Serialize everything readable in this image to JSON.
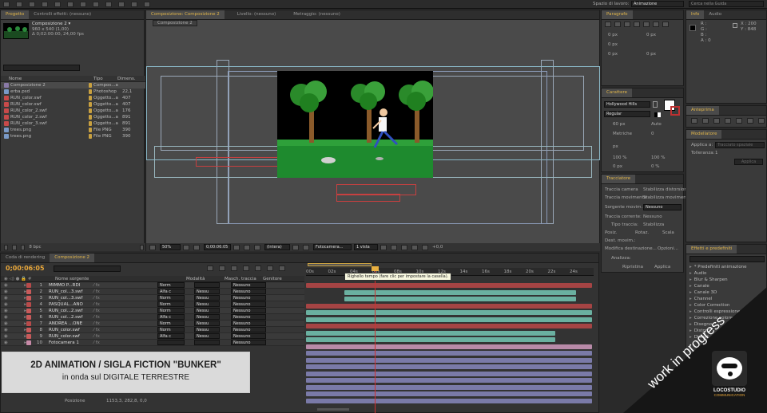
{
  "topbar": {
    "workspace_label": "Spazio di lavoro:",
    "workspace_value": "Animazione",
    "search_placeholder": "Cerca nella Guida"
  },
  "project": {
    "tab": "Progetto",
    "tab2": "Controlli effetti: (nessuno)",
    "selected_name": "Composizione 2 ▾",
    "selected_info1": "960 x 540 (1,00)",
    "selected_info2": "Δ 0;02:00:00, 24,00 fps",
    "headers": [
      "Nome",
      "Tipo",
      "Dimens."
    ],
    "items": [
      {
        "name": "Composizione 2",
        "type": "Compos...a",
        "size": "",
        "color": "#8a7aa8"
      },
      {
        "name": "erba.psd",
        "type": "Photoshop",
        "size": "22,1",
        "color": "#7a9ac8"
      },
      {
        "name": "RUN_color.swf",
        "type": "Oggetto...a",
        "size": "407",
        "color": "#c84a4a"
      },
      {
        "name": "RUN_color.swf",
        "type": "Oggetto...a",
        "size": "407",
        "color": "#c84a4a"
      },
      {
        "name": "RUN_color_2.swf",
        "type": "Oggetto...a",
        "size": "176",
        "color": "#c84a4a"
      },
      {
        "name": "RUN_color_2.swf",
        "type": "Oggetto...a",
        "size": "891",
        "color": "#c84a4a"
      },
      {
        "name": "RUN_color_3.swf",
        "type": "Oggetto...a",
        "size": "891",
        "color": "#c84a4a"
      },
      {
        "name": "trees.png",
        "type": "File PNG",
        "size": "390",
        "color": "#7a9ac8"
      },
      {
        "name": "trees.png",
        "type": "File PNG",
        "size": "390",
        "color": "#7a9ac8"
      }
    ],
    "bpc": "8 bpc"
  },
  "viewer": {
    "tab_comp": "Composizione: Composizione 2",
    "tab_layer": "Livello: (nessuno)",
    "tab_footage": "Metraggio: (nessuno)",
    "subtab": "Composizione 2",
    "zoom": "50%",
    "timecode": "0;00:06:05",
    "resolution": "(Intera)",
    "camera": "Fotocamera...",
    "views": "1 vista",
    "exposure": "+0,0"
  },
  "paragraph": {
    "tab": "Paragrafo",
    "values": [
      "0 px",
      "0 px",
      "0 px",
      "0 px",
      "0 px"
    ]
  },
  "info": {
    "tab": "Info",
    "tab2": "Audio",
    "x": "X : 200",
    "y": "Y : 848",
    "r": "R :",
    "g": "G :",
    "b": "B :",
    "a": "A : 0"
  },
  "preview": {
    "tab": "Anteprima"
  },
  "smoother": {
    "tab": "Modellatore",
    "apply_to_label": "Applica a:",
    "apply_to_value": "Tracciato spaziale",
    "tolerance_label": "Tolleranza:",
    "tolerance_value": "1",
    "apply_button": "Applica"
  },
  "character": {
    "tab": "Carattere",
    "font": "Hollywood Hills",
    "style": "Regular",
    "size": "60 px",
    "leading": "Auto",
    "kerning": "Metriche",
    "tracking": "0",
    "stroke": "px",
    "scale_v": "100 %",
    "scale_h": "100 %",
    "baseline": "0 px",
    "tsume": "0 %"
  },
  "tracker": {
    "tab": "Tracciatore",
    "btn1": "Traccia camera",
    "btn2": "Stabilizza distorsione",
    "btn3": "Traccia movimento",
    "btn4": "Stabilizza movimento",
    "source_label": "Sorgente movim.:",
    "source_value": "Nessuno",
    "current_track_label": "Traccia corrente:",
    "current_track_value": "Nessuno",
    "track_type_label": "Tipo traccia:",
    "track_type_value": "Stabilizza",
    "check1": "Posiz.",
    "check2": "Rotaz.",
    "check3": "Scala",
    "dest_label": "Dest. movim.:",
    "modify_target": "Modifica destinazione...",
    "options": "Opzioni...",
    "analyze_label": "Analizza:",
    "reset": "Ripristina",
    "apply": "Applica"
  },
  "effects": {
    "tab": "Effetti e predefiniti",
    "items": [
      "* Predefiniti animazione",
      "Audio",
      "Blur & Sharpen",
      "Canale",
      "Canale 3D",
      "Channel",
      "Color Correction",
      "Controlli espressione",
      "Correzione colore",
      "Disegno",
      "Distorci",
      "Distort"
    ]
  },
  "timeline": {
    "tab_render": "Coda di rendering",
    "tab_comp": "Composizione 2",
    "timecode": "0;00:06:05",
    "col_source": "Nome sorgente",
    "col_mode": "Modalità",
    "col_trackmatte": "Masch. traccia",
    "col_parent": "Genitore",
    "layers": [
      {
        "num": "1",
        "name": "MIMMO P...RDI",
        "mode": "Norm",
        "matte": "",
        "parent": "Nessuno",
        "color": "#b84a4a"
      },
      {
        "num": "2",
        "name": "RUN_col...3.swf",
        "mode": "Alfa c",
        "matte": "Nessu",
        "parent": "Nessuno",
        "color": "#c85a5a"
      },
      {
        "num": "3",
        "name": "RUN_col...3.swf",
        "mode": "Norm",
        "matte": "Nessu",
        "parent": "Nessuno",
        "color": "#c85a5a"
      },
      {
        "num": "4",
        "name": "PASQUAL...ANO",
        "mode": "Norm",
        "matte": "Nessu",
        "parent": "Nessuno",
        "color": "#b84a4a"
      },
      {
        "num": "5",
        "name": "RUN_col...2.swf",
        "mode": "Norm",
        "matte": "Nessu",
        "parent": "Nessuno",
        "color": "#c85a5a"
      },
      {
        "num": "6",
        "name": "RUN_col...2.swf",
        "mode": "Alfa c",
        "matte": "Nessu",
        "parent": "Nessuno",
        "color": "#c85a5a"
      },
      {
        "num": "7",
        "name": "ANDREA ...ONE",
        "mode": "Norm",
        "matte": "Nessu",
        "parent": "Nessuno",
        "color": "#b84a4a"
      },
      {
        "num": "8",
        "name": "RUN_color.swf",
        "mode": "Norm",
        "matte": "Nessu",
        "parent": "Nessuno",
        "color": "#c85a5a"
      },
      {
        "num": "9",
        "name": "RUN_color.swf",
        "mode": "Alfa c",
        "matte": "Nessu",
        "parent": "Nessuno",
        "color": "#c85a5a"
      },
      {
        "num": "10",
        "name": "Fotocamera 1",
        "mode": "",
        "matte": "",
        "parent": "Nessuno",
        "color": "#c88aa8"
      }
    ],
    "ruler_labels": [
      "00s",
      "02s",
      "04s",
      "06s",
      "08s",
      "10s",
      "12s",
      "14s",
      "16s",
      "18s",
      "20s",
      "22s",
      "24s"
    ],
    "tooltip": "Righello tempo (fare clic per impostare la casella).",
    "position_label": "Posizione",
    "position_value": "1153,3, 282,8, 0,0"
  },
  "overlay": {
    "title": "2D ANIMATION / SIGLA FICTION \"BUNKER\"",
    "subtitle": "in onda sul DIGITALE TERRESTRE",
    "banner": "work in progress",
    "logo_line1": "LOCOSTUDIO",
    "logo_line2": "COMMUNICATION"
  },
  "colors": {
    "accent_orange": "#e8a73a",
    "bar_red": "#a54444",
    "bar_teal": "#6ab0a0",
    "bar_pink": "#b88aa8",
    "bar_purple": "#7a7aa8",
    "playhead": "#d03030"
  }
}
